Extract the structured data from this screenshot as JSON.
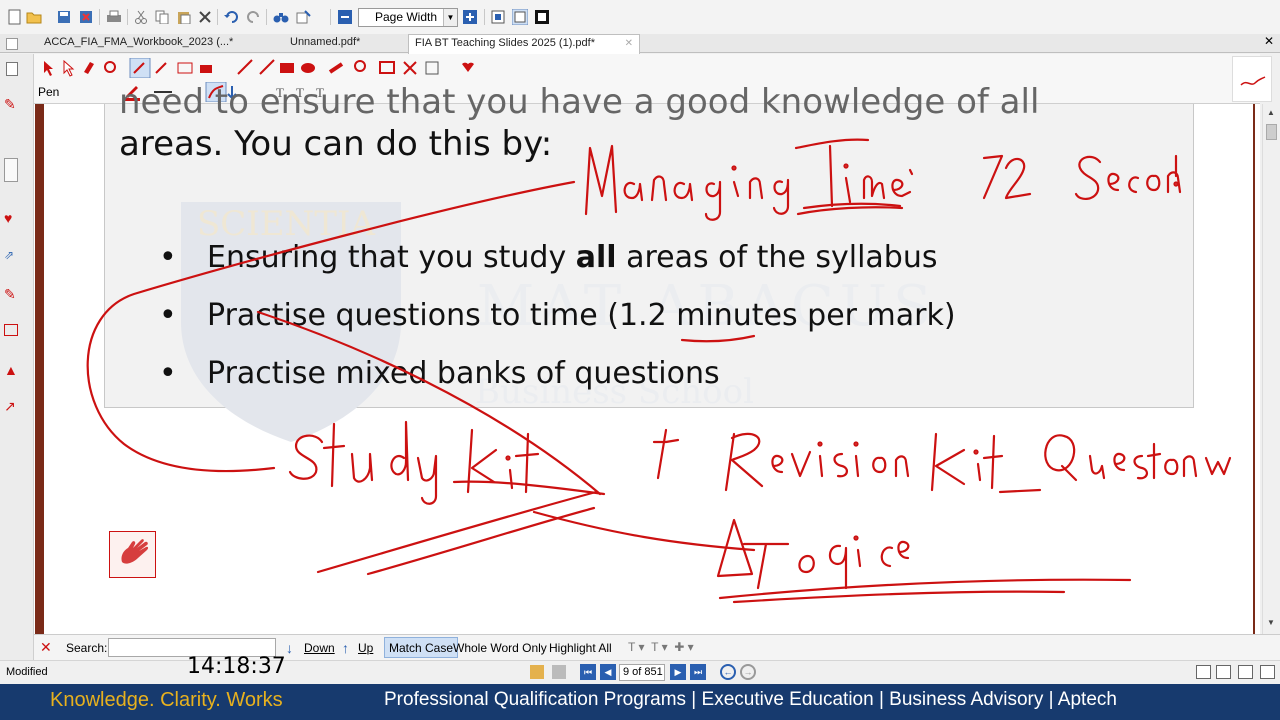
{
  "toolbar": {
    "zoom_value": "Page Width",
    "icons": [
      "new-icon",
      "open-icon",
      "save-icon",
      "save-as-icon",
      "print-icon",
      "cut-icon",
      "copy-icon",
      "paste-icon",
      "delete-icon",
      "undo-icon",
      "redo-icon",
      "find-icon",
      "select-icon",
      "zoom-out-icon",
      "zoom-in-icon",
      "fit-page-icon",
      "fit-width-icon",
      "fullscreen-icon"
    ]
  },
  "tabs": [
    {
      "label": "ACCA_FIA_FMA_Workbook_2023 (...*"
    },
    {
      "label": "Unnamed.pdf*"
    },
    {
      "label": "FIA BT Teaching Slides 2025 (1).pdf*"
    }
  ],
  "annotation_toolbar": {
    "mode_label": "Pen",
    "colors": {
      "accent": "#cc1111",
      "footer": "#173a6e",
      "footer_gold": "#e8b11e",
      "page_border": "#7a2a18"
    }
  },
  "slide": {
    "line1": "need to ensure that you have a good knowledge of all",
    "line2": "areas. You can do this by:",
    "bullet_glyph": "•",
    "bullets": [
      {
        "pre": "Ensuring that you study ",
        "bold": "all",
        "post": " areas of the syllabus"
      },
      {
        "pre": "Practise questions to time (1.2 minutes per mark)",
        "bold": "",
        "post": ""
      },
      {
        "pre": "Practise mixed banks of questions",
        "bold": "",
        "post": ""
      }
    ],
    "watermark_top": "SCIENTIA",
    "watermark_mid": "MAT ABACUS",
    "watermark_sub": "Business School"
  },
  "findbar": {
    "search_label": "Search:",
    "search_value": "",
    "down_label": "Down",
    "up_label": "Up",
    "match_case": "Match Case",
    "whole_word": "Whole Word Only",
    "highlight_all": "Highlight All"
  },
  "status": {
    "state": "Modified",
    "page_counter": "9 of 851"
  },
  "clock": "14:18:37",
  "footer": {
    "tagline": "Knowledge. Clarity. Works",
    "programs": "Professional Qualification Programs | Executive Education | Business Advisory | Aptech"
  }
}
